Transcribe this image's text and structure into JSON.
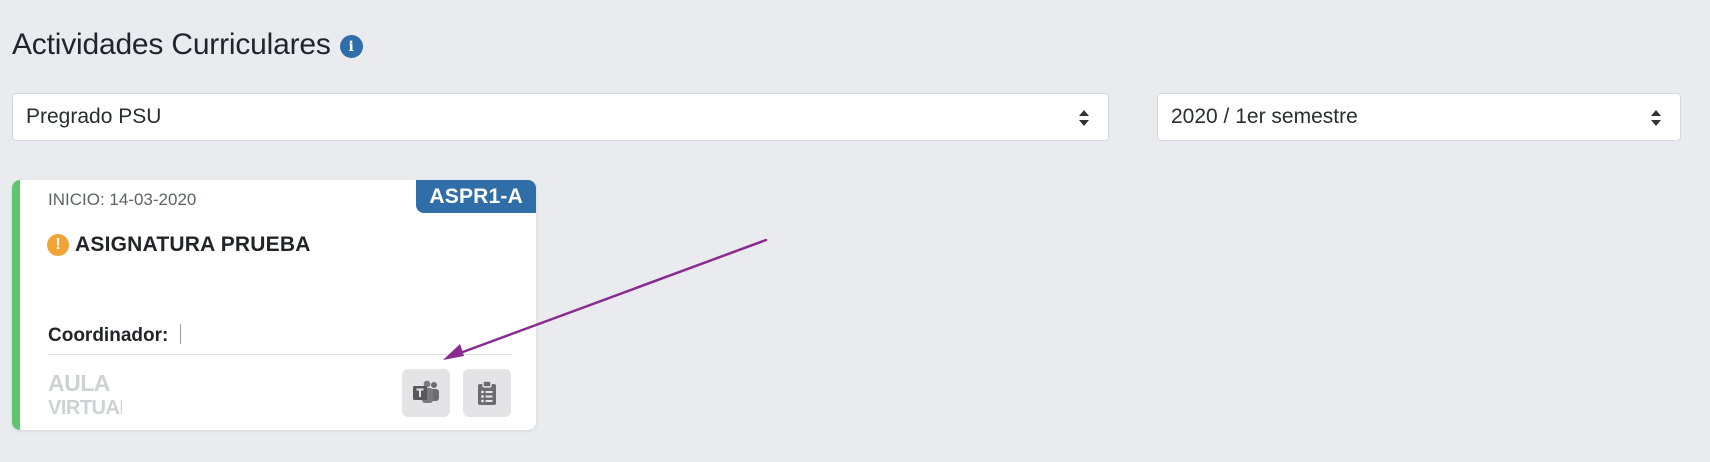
{
  "page": {
    "title": "Actividades Curriculares",
    "info_icon": "info-icon"
  },
  "filters": {
    "program": {
      "selected": "Pregrado PSU"
    },
    "period": {
      "selected": "2020 / 1er semestre"
    }
  },
  "course_card": {
    "code": "ASPR1-A",
    "start_date": "INICIO: 14-03-2020",
    "status_icon": "warning-icon",
    "name": "ASIGNATURA PRUEBA",
    "coordinator_label": "Coordinador:",
    "logo_lines": [
      "AULA",
      "VIRTUAL"
    ],
    "actions": [
      {
        "icon": "teams-icon"
      },
      {
        "icon": "clipboard-icon"
      }
    ]
  },
  "colors": {
    "accent_blue": "#2f6ea8",
    "status_green": "#5cc76e",
    "warning_orange": "#f0a436",
    "annotation_purple": "#8a2b8f",
    "background": "#eaebef"
  }
}
